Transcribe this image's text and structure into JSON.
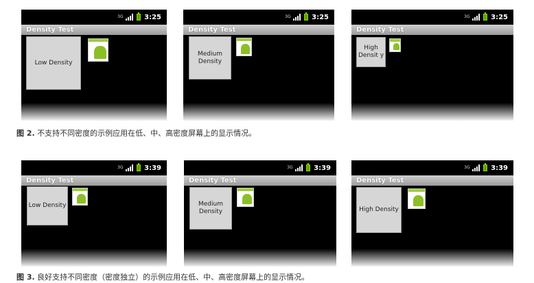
{
  "figure2": {
    "caption_label": "图 2.",
    "caption_text": " 不支持不同密度的示例应用在低、中、高密度屏幕上的显示情况。",
    "screens": [
      {
        "time": "3:25",
        "title": "Density Test",
        "button_label": "Low Density"
      },
      {
        "time": "3:25",
        "title": "Density Test",
        "button_label": "Medium Density"
      },
      {
        "time": "3:25",
        "title": "Density Test",
        "button_label": "High Densit y"
      }
    ]
  },
  "figure3": {
    "caption_label": "图 3.",
    "caption_text": " 良好支持不同密度（密度独立）的示例应用在低、中、高密度屏幕上的显示情况。",
    "screens": [
      {
        "time": "3:39",
        "title": "Density Test",
        "button_label": "Low Density"
      },
      {
        "time": "3:39",
        "title": "Density Test",
        "button_label": "Medium Density"
      },
      {
        "time": "3:39",
        "title": "Density Test",
        "button_label": "High Density"
      }
    ]
  },
  "status_icons": {
    "network": "3G",
    "signal": "signal-icon",
    "battery": "battery-icon"
  }
}
